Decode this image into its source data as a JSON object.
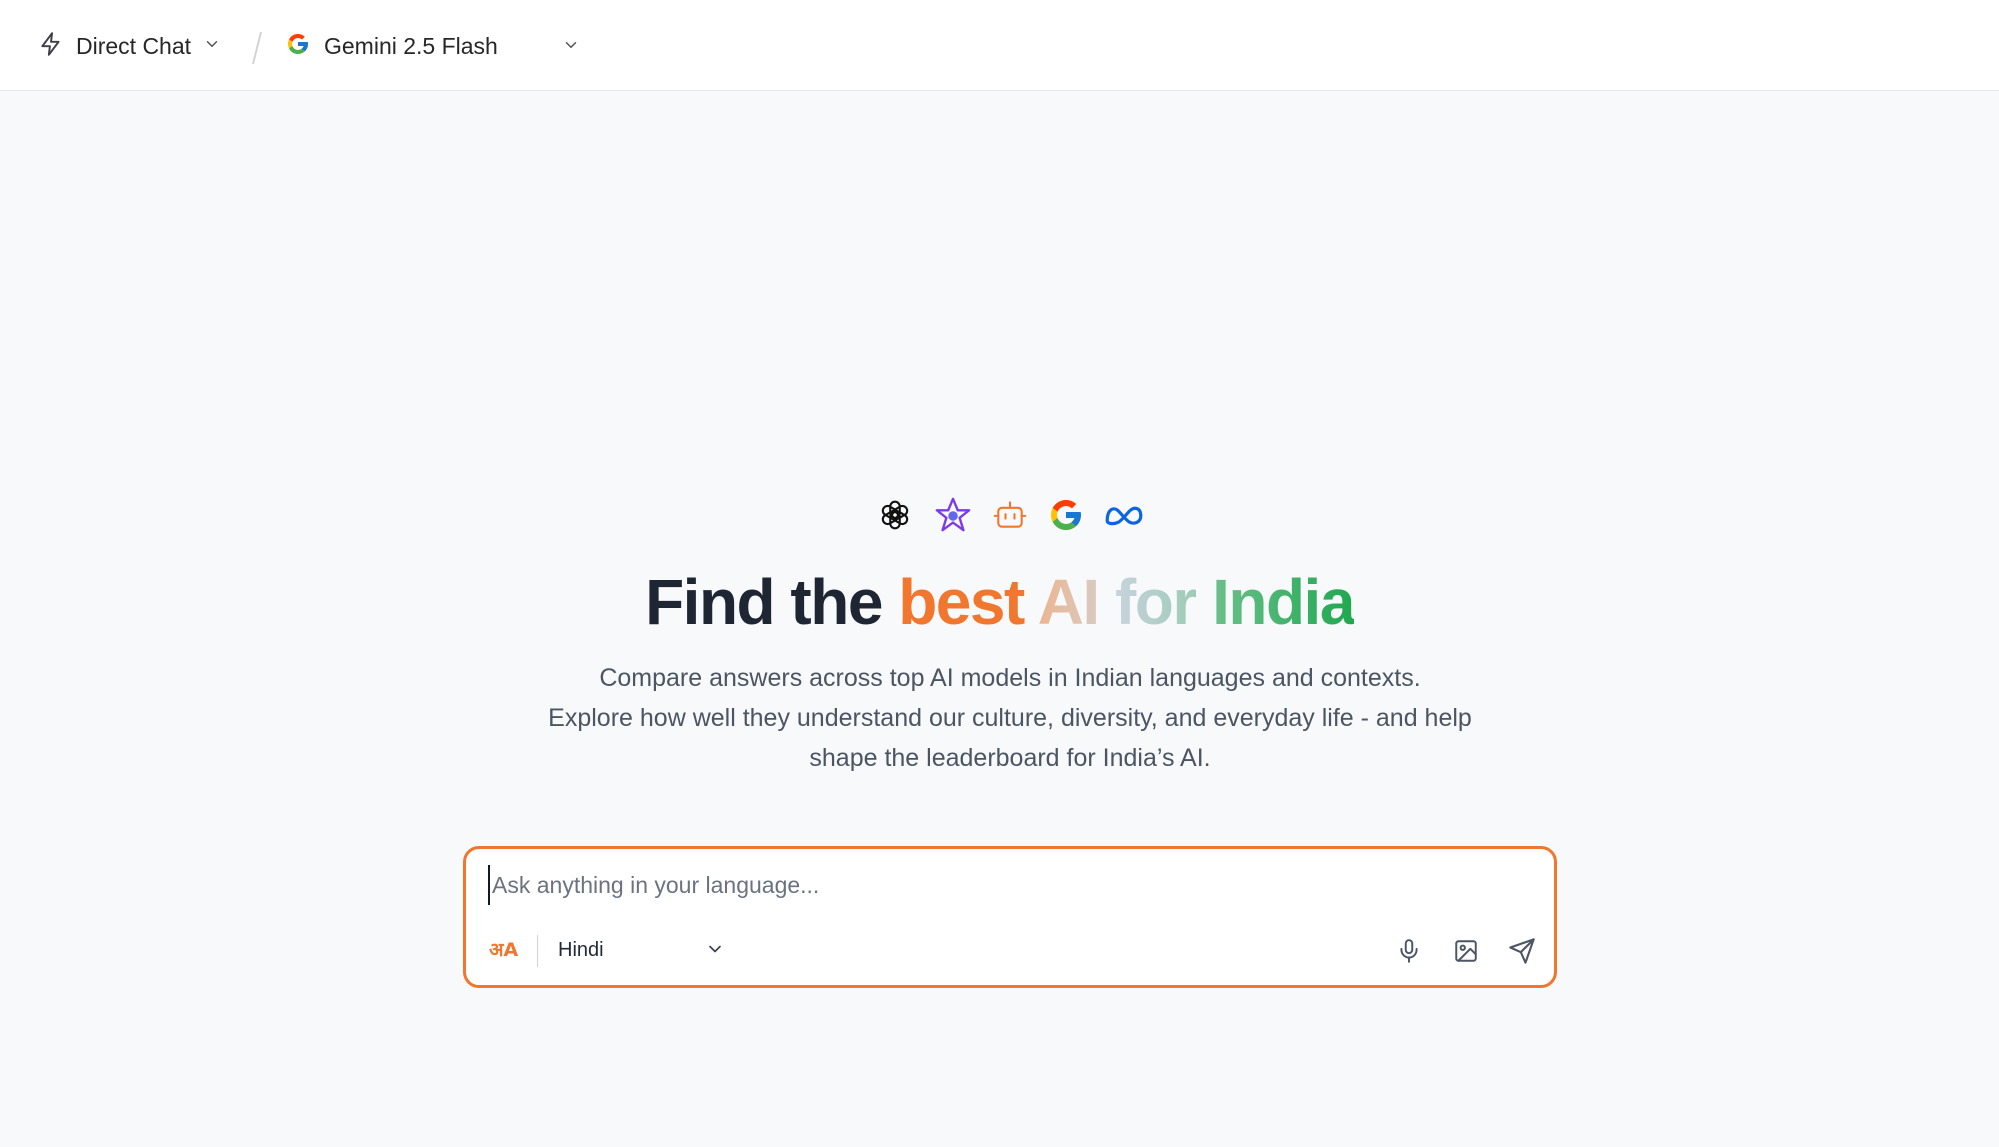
{
  "header": {
    "mode_label": "Direct Chat",
    "model_label": "Gemini 2.5 Flash",
    "mode_icon": "lightning-icon",
    "model_icon": "google-icon"
  },
  "hero": {
    "model_icons": [
      "openai-icon",
      "sarvam-star-icon",
      "robot-icon",
      "google-icon",
      "meta-icon"
    ],
    "headline": {
      "part1": "Find the",
      "part2": "best",
      "part3": "AI",
      "part4": "for",
      "part5": "India"
    },
    "subtitle_lines": [
      "Compare answers across top AI models in Indian languages and contexts.",
      "Explore how well they understand our culture, diversity, and everyday life - and help",
      "shape the leaderboard for India’s AI."
    ]
  },
  "chat": {
    "placeholder": "Ask anything in your language...",
    "value": "",
    "language": "Hindi",
    "language_icon": "अA"
  },
  "colors": {
    "accent_orange": "#f0772d",
    "india_green": "#1fa84f",
    "text_dark": "#1e2533"
  }
}
